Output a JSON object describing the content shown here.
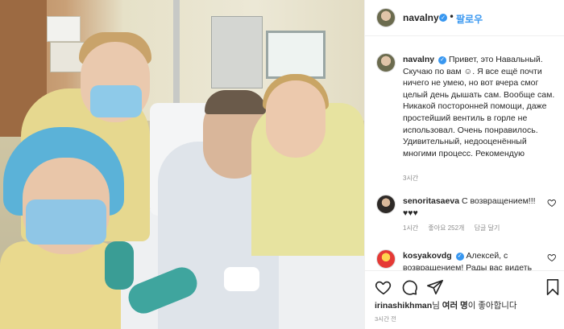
{
  "header": {
    "username": "navalny",
    "separator": "•",
    "follow_label": "팔로우"
  },
  "caption": {
    "username": "navalny",
    "text": "Привет, это Навальный. Скучаю по вам ☺. Я все ещё почти ничего не умею, но вот вчера смог целый день дышать сам. Вообще сам. Никакой посторонней помощи, даже простейший вентиль в горле не использовал. Очень понравилось. Удивительный, недооценённый многими процесс. Рекомендую",
    "time": "3시간"
  },
  "comments": [
    {
      "username": "senoritasaeva",
      "text": "С возвращением!!! ♥♥♥",
      "time": "1시간",
      "likes": "좋아요 252개",
      "reply": "답글 달기"
    },
    {
      "username": "kosyakovdg",
      "text": "Алексей, с возвращением! Рады вас видеть"
    }
  ],
  "likes": {
    "user": "irinashikhman",
    "middle": "님 ",
    "bold_text": "여러 명",
    "suffix": "이 좋아합니다"
  },
  "post_time": "3시간 전",
  "icons": {
    "verified": "verified-badge-icon",
    "like": "heart-icon",
    "comment": "comment-icon",
    "share": "paper-plane-icon",
    "save": "bookmark-icon"
  },
  "colors": {
    "link_blue": "#3897f0",
    "text": "#262626",
    "muted": "#8e8e8e",
    "border": "#efefef"
  }
}
